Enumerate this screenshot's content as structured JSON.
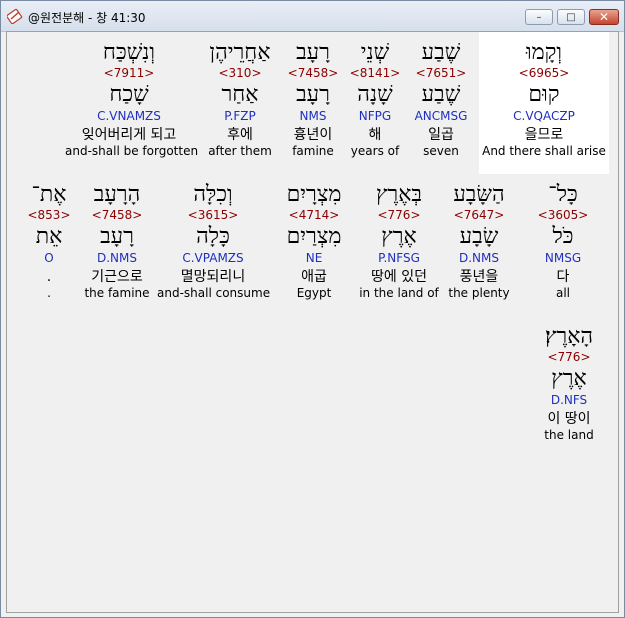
{
  "window": {
    "title": "@원전분해 - 창 41:30",
    "buttons": {
      "minimize": "–",
      "maximize": "□",
      "close": "✕"
    }
  },
  "rows": [
    {
      "words": [
        {
          "heb": "וְקָמוּ",
          "strong": "<6965>",
          "lemma": "קוּם",
          "morph": "C.VQACZP",
          "korean": "을므로",
          "english": "And there shall arise",
          "highlight": true
        },
        {
          "heb": "שֶׁבַע",
          "strong": "<7651>",
          "lemma": "שֶׁבַע",
          "morph": "ANCMSG",
          "korean": "일곱",
          "english": "seven"
        },
        {
          "heb": "שְׁנֵי",
          "strong": "<8141>",
          "lemma": "שָׁנָה",
          "morph": "NFPG",
          "korean": "해",
          "english": "years of"
        },
        {
          "heb": "רָעָב",
          "strong": "<7458>",
          "lemma": "רָעָב",
          "morph": "NMS",
          "korean": "흉년이",
          "english": "famine"
        },
        {
          "heb": "אַחֲרֵיהֶן",
          "strong": "<310>",
          "lemma": "אַחַר",
          "morph": "P.FZP",
          "korean": "후에",
          "english": "after them"
        },
        {
          "heb": "וְנִשְׁכַּח",
          "strong": "<7911>",
          "lemma": "שָׁכַח",
          "morph": "C.VNAMZS",
          "korean": "잊어버리게 되고",
          "english": "and-shall be forgotten"
        }
      ]
    },
    {
      "words": [
        {
          "heb": "כָּל־",
          "strong": "<3605>",
          "lemma": "כֹּל",
          "morph": "NMSG",
          "korean": "다",
          "english": "all"
        },
        {
          "heb": "הַשָּׂבָע",
          "strong": "<7647>",
          "lemma": "שָׂבָע",
          "morph": "D.NMS",
          "korean": "풍년을",
          "english": "the plenty"
        },
        {
          "heb": "בְּאֶרֶץ",
          "strong": "<776>",
          "lemma": "אֶרֶץ",
          "morph": "P.NFSG",
          "korean": "땅에 있던",
          "english": "in the land of"
        },
        {
          "heb": "מִצְרָיִם",
          "strong": "<4714>",
          "lemma": "מִצְרַיִם",
          "morph": "NE",
          "korean": "애굽",
          "english": "Egypt"
        },
        {
          "heb": "וְכִלָּה",
          "strong": "<3615>",
          "lemma": "כָּלָה",
          "morph": "C.VPAMZS",
          "korean": "멸망되리니",
          "english": "and-shall consume"
        },
        {
          "heb": "הָרָעָב",
          "strong": "<7458>",
          "lemma": "רָעָב",
          "morph": "D.NMS",
          "korean": "기근으로",
          "english": "the famine"
        },
        {
          "heb": "אֶת־",
          "strong": "<853>",
          "lemma": "אֵת",
          "morph": "O",
          "korean": ".",
          "english": "."
        }
      ]
    },
    {
      "words": [
        {
          "heb": "הָאָרֶץ׃",
          "strong": "<776>",
          "lemma": "אֶרֶץ",
          "morph": "D.NFS",
          "korean": "이 땅이",
          "english": "the land"
        }
      ]
    }
  ]
}
